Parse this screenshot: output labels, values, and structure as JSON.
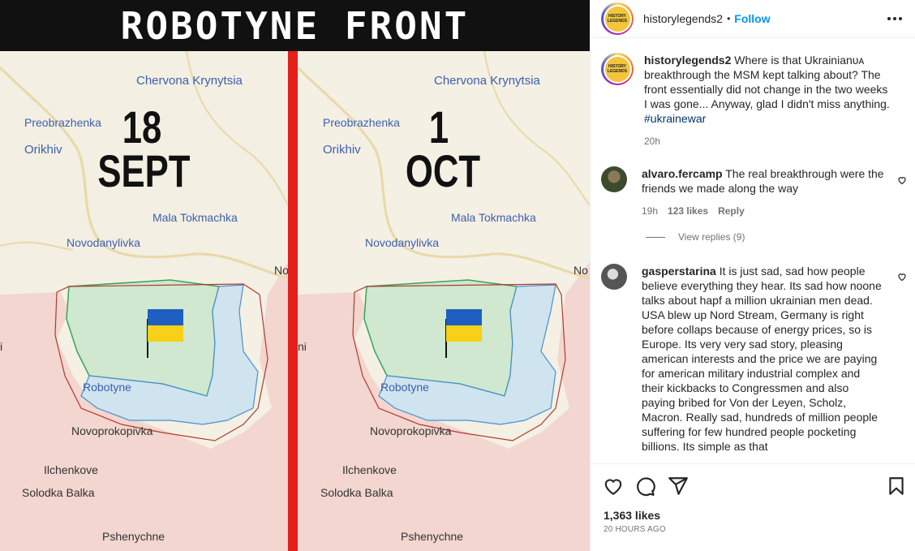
{
  "banner": {
    "title": "ROBOTYNE FRONT"
  },
  "maps": {
    "left": {
      "date_day": "18",
      "date_month": "SEPT",
      "places": [
        "Chervona Krynytsia",
        "Preobrazhenka",
        "Orikhiv",
        "Mala Tokmachka",
        "Novodanylivka",
        "Robotyne",
        "Novoprokopivka",
        "Ilchenkove",
        "Solodka Balka",
        "Pshenychne",
        "No",
        "i"
      ]
    },
    "right": {
      "date_day": "1",
      "date_month": "OCT",
      "places": [
        "Chervona Krynytsia",
        "Preobrazhenka",
        "Orikhiv",
        "Mala Tokmachka",
        "Novodanylivka",
        "Robotyne",
        "Novoprokopivka",
        "Ilchenkove",
        "Solodka Balka",
        "Pshenychne",
        "No",
        "ni"
      ]
    },
    "colors": {
      "occupied": "#f2d6cf",
      "liberated": "#cfe8cf",
      "contested": "#cfe4ef",
      "front_divider": "#e2201c"
    }
  },
  "post": {
    "author": "historylegends2",
    "separator": "•",
    "follow_label": "Follow",
    "avatar_text": "HISTORY LEGENDS",
    "caption": {
      "username": "historylegends2",
      "text": "Where is that Ukrainianᴜᴀ breakthrough the MSM kept talking about? The front essentially did not change in the two weeks I was gone... Anyway, glad I didn't miss anything.",
      "hashtag": "#ukrainewar",
      "time": "20h"
    },
    "comments": [
      {
        "username": "alvaro.fercamp",
        "text": "The real breakthrough were the friends we made along the way",
        "time": "19h",
        "likes": "123 likes",
        "reply_label": "Reply",
        "view_replies": "View replies (9)"
      },
      {
        "username": "gasperstarina",
        "text": "It is just sad, sad how people believe everything they hear. Its sad how noone talks about hapf a million ukrainian men dead. USA blew up Nord Stream, Germany is right before collaps because of energy prices, so is Europe. Its very very sad story, pleasing american interests and the price we are paying for american military industrial complex and their kickbacks to Congressmen and also paying bribed for Von der Leyen, Scholz, Macron. Really sad, hundreds of million people suffering for few hundred people pocketing billions. Its simple as that"
      }
    ],
    "likes_count": "1,363 likes",
    "posted_ago": "20 HOURS AGO",
    "icons": [
      "more-icon",
      "heart-icon",
      "comment-icon",
      "share-icon",
      "bookmark-icon"
    ]
  }
}
